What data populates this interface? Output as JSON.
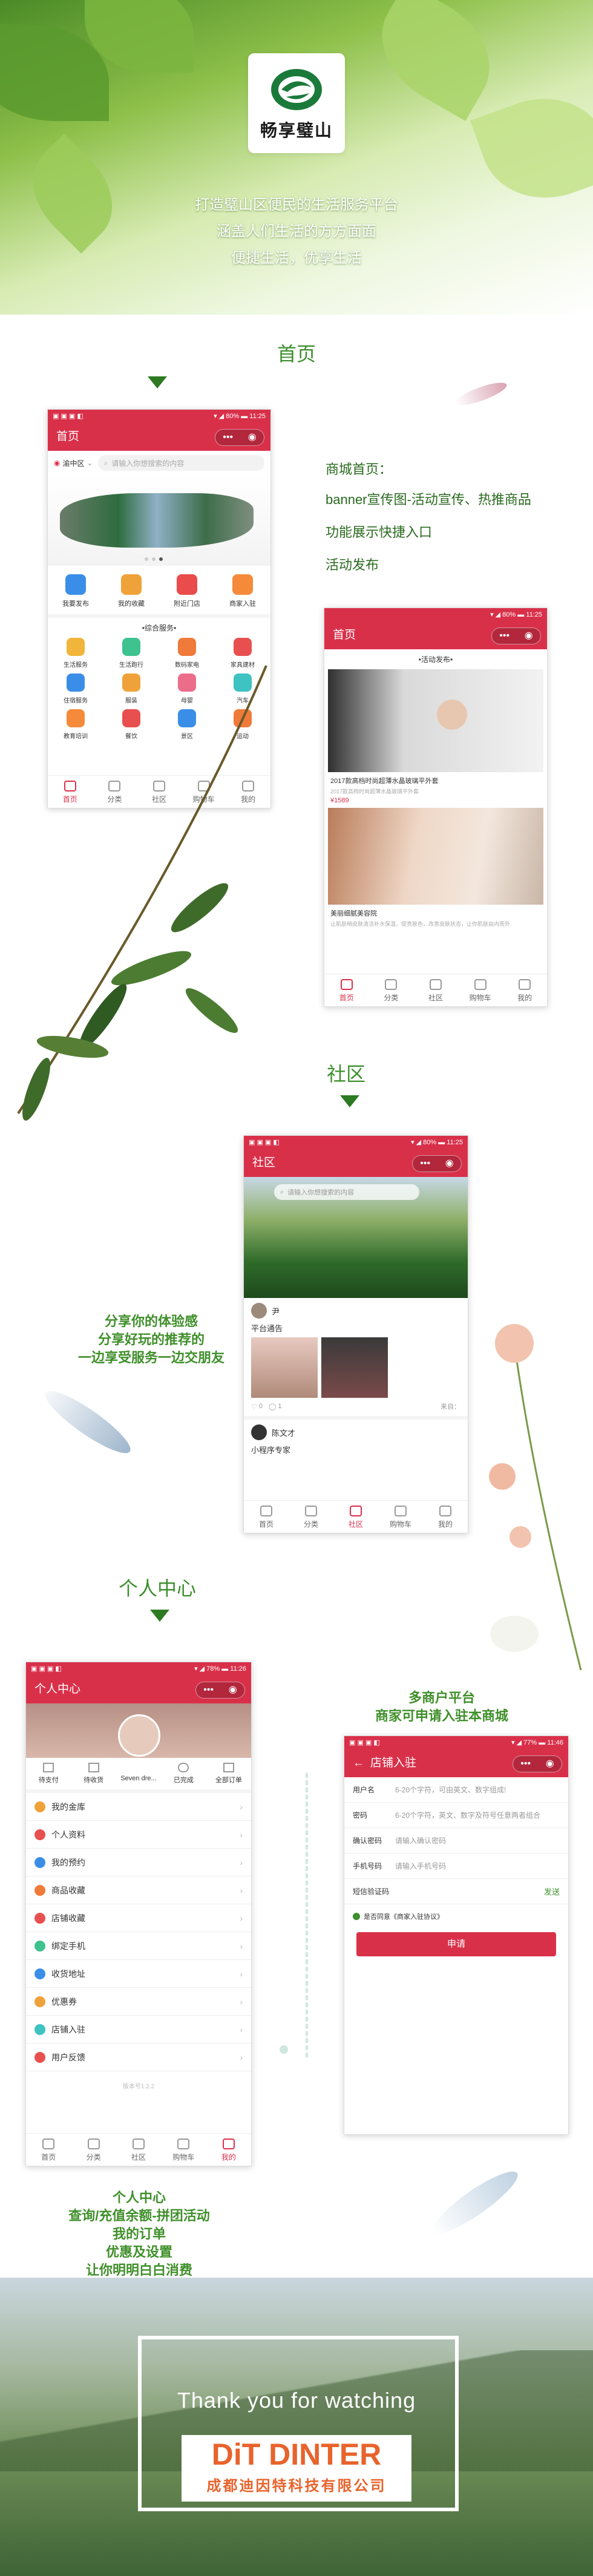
{
  "hero": {
    "logo_text": "畅享璧山",
    "lines": [
      "打造璧山区便民的生活服务平台",
      "涵盖人们生活的方方面面",
      "便捷生活，优享生活"
    ]
  },
  "home": {
    "section_title": "首页",
    "status_left": "▣ ▣ ▣ ◧",
    "status_right": "▾ ◢ 80% ▬ 11:25",
    "nav_title": "首页",
    "capsule": [
      "•••",
      "◉"
    ],
    "location": "渝中区",
    "search_placeholder": "请输入你想搜索的内容",
    "quick": [
      "我要发布",
      "我的收藏",
      "附近门店",
      "商家入驻"
    ],
    "service_title": "•综合服务•",
    "services": [
      "生活服务",
      "生活跑行",
      "数码家电",
      "家具建材",
      "住宿服务",
      "服装",
      "母婴",
      "汽车",
      "教育培训",
      "餐饮",
      "景区",
      "运动"
    ],
    "tabs": [
      "首页",
      "分类",
      "社区",
      "购物车",
      "我的"
    ],
    "annotations": [
      "商城首页：",
      "banner宣传图-活动宣传、热推商品",
      "功能展示快捷入口",
      "活动发布"
    ]
  },
  "activity": {
    "status_right": "▾ ◢ 80% ▬ 11:25",
    "nav_title": "首页",
    "section_title": "•活动发布•",
    "item1_title": "2017款高档时尚超薄水晶玻璃平外套",
    "item1_desc": "2017款高档时尚超薄水晶玻璃平外套",
    "item1_price": "¥1589",
    "item2_title": "美丽细腻美容院",
    "item2_desc": "让肌肤稍皮肤清洁补水保湿，提亮肤色，改善皮肤状态，让你肌肤由内而外"
  },
  "community": {
    "section_title": "社区",
    "status_right": "▾ ◢ 80% ▬ 11:25",
    "nav_title": "社区",
    "search_placeholder": "请输入你想搜索的内容",
    "post1_user": "尹",
    "post1_title": "平台通告",
    "post1_likes": "0",
    "post1_comments": "1",
    "post1_meta": "来自：",
    "post2_user": "陈文才",
    "post2_title": "小程序专家",
    "annotations": [
      "分享你的体验感",
      "分享好玩的推荐的",
      "一边享受服务一边交朋友"
    ]
  },
  "profile": {
    "section_title": "个人中心",
    "status_right": "▾ ◢ 78% ▬ 11:26",
    "nav_title": "个人中心",
    "user_name": "Seven dre...",
    "orders": [
      "待支付",
      "待收货",
      "已完成",
      "全部订单"
    ],
    "menu": [
      "我的金库",
      "个人资料",
      "我的预约",
      "商品收藏",
      "店铺收藏",
      "绑定手机",
      "收货地址",
      "优惠券",
      "店铺入驻",
      "用户反馈"
    ],
    "version": "版本号1.2.2",
    "annotations": [
      "个人中心",
      "查询/充值余额-拼团活动",
      "我的订单",
      "优惠及设置",
      "让你明明白白消费"
    ]
  },
  "merchant": {
    "annotations": [
      "多商户平台",
      "商家可申请入驻本商城"
    ],
    "status_right": "▾ ◢ 77% ▬ 11:46",
    "nav_title": "店铺入驻",
    "fields": [
      {
        "label": "用户名",
        "value": "6-20个字符，可由英文、数字组成!"
      },
      {
        "label": "密码",
        "value": "6-20个字符，英文、数字及符号任意两者组合"
      },
      {
        "label": "确认密码",
        "value": "请输入确认密码"
      },
      {
        "label": "手机号码",
        "value": "请输入手机号码"
      },
      {
        "label": "短信验证码",
        "value": ""
      }
    ],
    "send_code": "发送",
    "agree_text": "是否同意《商家入驻协议》",
    "submit": "申请"
  },
  "footer": {
    "thanks": "Thank you for watching",
    "brand": "DINTER",
    "brand_prefix": "DiT",
    "company": "成都迪因特科技有限公司"
  },
  "colors": {
    "accent": "#d9304a",
    "green": "#3c8f2d"
  }
}
